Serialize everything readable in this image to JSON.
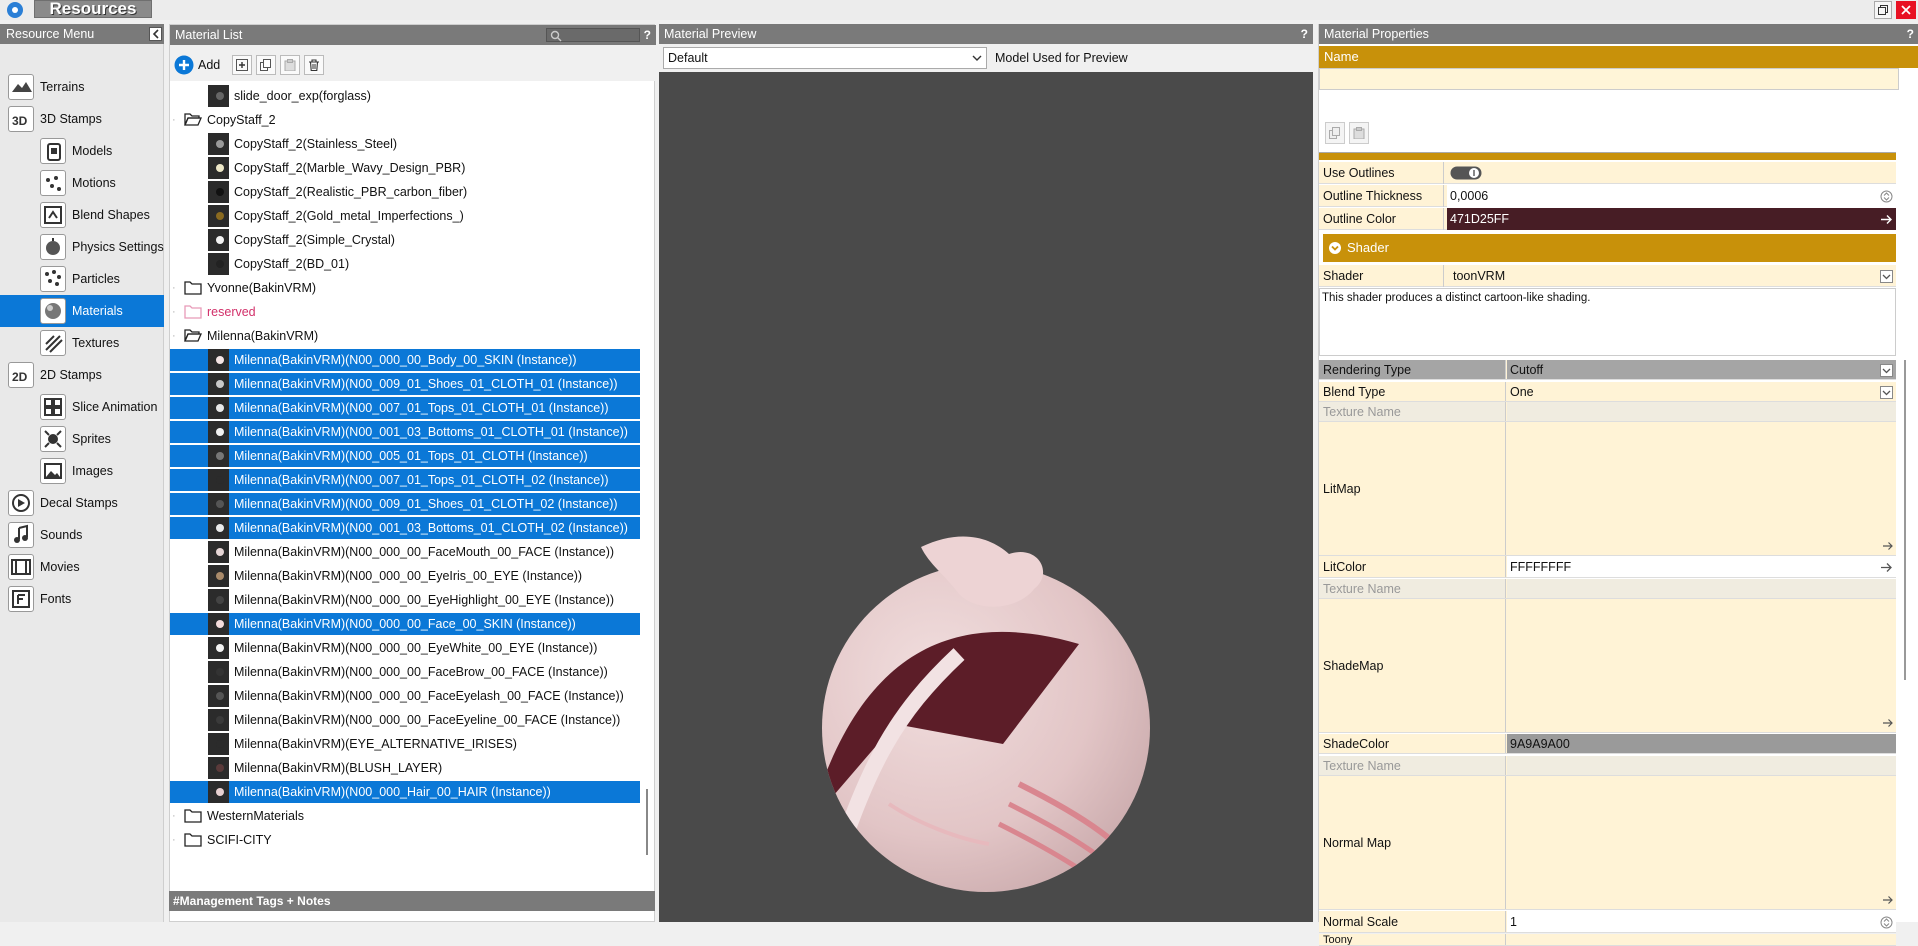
{
  "titlebar": {
    "title": "Resources"
  },
  "resource_menu": {
    "title": "Resource Menu",
    "items": [
      {
        "label": "Terrains",
        "icon": "terrain-icon",
        "selected": false,
        "sub": false
      },
      {
        "label": "3D Stamps",
        "icon": "3d-stamps-icon",
        "selected": false,
        "sub": false
      },
      {
        "label": "Models",
        "icon": "model-icon",
        "selected": false,
        "sub": true
      },
      {
        "label": "Motions",
        "icon": "motion-icon",
        "selected": false,
        "sub": true
      },
      {
        "label": "Blend Shapes",
        "icon": "blend-shapes-icon",
        "selected": false,
        "sub": true
      },
      {
        "label": "Physics Settings",
        "icon": "physics-icon",
        "selected": false,
        "sub": true
      },
      {
        "label": "Particles",
        "icon": "particles-icon",
        "selected": false,
        "sub": true
      },
      {
        "label": "Materials",
        "icon": "materials-icon",
        "selected": true,
        "sub": true
      },
      {
        "label": "Textures",
        "icon": "textures-icon",
        "selected": false,
        "sub": true
      },
      {
        "label": "2D Stamps",
        "icon": "2d-stamps-icon",
        "selected": false,
        "sub": false
      },
      {
        "label": "Slice Animation",
        "icon": "slice-animation-icon",
        "selected": false,
        "sub": true
      },
      {
        "label": "Sprites",
        "icon": "sprites-icon",
        "selected": false,
        "sub": true
      },
      {
        "label": "Images",
        "icon": "images-icon",
        "selected": false,
        "sub": true
      },
      {
        "label": "Decal Stamps",
        "icon": "decal-icon",
        "selected": false,
        "sub": false
      },
      {
        "label": "Sounds",
        "icon": "sound-icon",
        "selected": false,
        "sub": false
      },
      {
        "label": "Movies",
        "icon": "movie-icon",
        "selected": false,
        "sub": false
      },
      {
        "label": "Fonts",
        "icon": "font-icon",
        "selected": false,
        "sub": false
      }
    ]
  },
  "material_list": {
    "title": "Material List",
    "help": "?",
    "add_label": "Add",
    "rows": [
      {
        "kind": "material",
        "text": "slide_door_exp(forglass)",
        "selected": false,
        "dot": "#666"
      },
      {
        "kind": "folder-open",
        "text": "CopyStaff_2",
        "selected": false
      },
      {
        "kind": "material",
        "text": "CopyStaff_2(Stainless_Steel)",
        "selected": false,
        "dot": "#999"
      },
      {
        "kind": "material",
        "text": "CopyStaff_2(Marble_Wavy_Design_PBR)",
        "selected": false,
        "dot": "#eee8c8"
      },
      {
        "kind": "material",
        "text": "CopyStaff_2(Realistic_PBR_carbon_fiber)",
        "selected": false,
        "dot": "#111"
      },
      {
        "kind": "material",
        "text": "CopyStaff_2(Gold_metal_Imperfections_)",
        "selected": false,
        "dot": "#8a6a20"
      },
      {
        "kind": "material",
        "text": "CopyStaff_2(Simple_Crystal)",
        "selected": false,
        "dot": "#f2f2f2"
      },
      {
        "kind": "material",
        "text": "CopyStaff_2(BD_01)",
        "selected": false,
        "dot": "#222"
      },
      {
        "kind": "folder",
        "text": "Yvonne(BakinVRM)",
        "selected": false
      },
      {
        "kind": "folder-pink",
        "text": "reserved",
        "selected": false
      },
      {
        "kind": "folder-open",
        "text": "Milenna(BakinVRM)",
        "selected": false
      },
      {
        "kind": "material",
        "text": "Milenna(BakinVRM)(N00_000_00_Body_00_SKIN (Instance))",
        "selected": true,
        "dot": "#f4e4e4"
      },
      {
        "kind": "material",
        "text": "Milenna(BakinVRM)(N00_009_01_Shoes_01_CLOTH_01 (Instance))",
        "selected": true,
        "dot": "#c8c8c8"
      },
      {
        "kind": "material",
        "text": "Milenna(BakinVRM)(N00_007_01_Tops_01_CLOTH_01 (Instance))",
        "selected": true,
        "dot": "#e8e8e8"
      },
      {
        "kind": "material",
        "text": "Milenna(BakinVRM)(N00_001_03_Bottoms_01_CLOTH_01 (Instance))",
        "selected": true,
        "dot": "#f0f0f0"
      },
      {
        "kind": "material",
        "text": "Milenna(BakinVRM)(N00_005_01_Tops_01_CLOTH (Instance))",
        "selected": true,
        "dot": "#777"
      },
      {
        "kind": "material",
        "text": "Milenna(BakinVRM)(N00_007_01_Tops_01_CLOTH_02 (Instance))",
        "selected": true,
        "dot": "#2b2b2b"
      },
      {
        "kind": "material",
        "text": "Milenna(BakinVRM)(N00_009_01_Shoes_01_CLOTH_02 (Instance))",
        "selected": true,
        "dot": "#555"
      },
      {
        "kind": "material",
        "text": "Milenna(BakinVRM)(N00_001_03_Bottoms_01_CLOTH_02 (Instance))",
        "selected": true,
        "dot": "#eaeaea"
      },
      {
        "kind": "material",
        "text": "Milenna(BakinVRM)(N00_000_00_FaceMouth_00_FACE (Instance))",
        "selected": false,
        "dot": "#e6d6d6"
      },
      {
        "kind": "material",
        "text": "Milenna(BakinVRM)(N00_000_00_EyeIris_00_EYE (Instance))",
        "selected": false,
        "dot": "#a98a6a"
      },
      {
        "kind": "material",
        "text": "Milenna(BakinVRM)(N00_000_00_EyeHighlight_00_EYE (Instance))",
        "selected": false,
        "dot": "#444"
      },
      {
        "kind": "material",
        "text": "Milenna(BakinVRM)(N00_000_00_Face_00_SKIN (Instance))",
        "selected": true,
        "dot": "#f4dcdc"
      },
      {
        "kind": "material",
        "text": "Milenna(BakinVRM)(N00_000_00_EyeWhite_00_EYE (Instance))",
        "selected": false,
        "dot": "#f4f4f4"
      },
      {
        "kind": "material",
        "text": "Milenna(BakinVRM)(N00_000_00_FaceBrow_00_FACE (Instance))",
        "selected": false,
        "dot": "#333"
      },
      {
        "kind": "material",
        "text": "Milenna(BakinVRM)(N00_000_00_FaceEyelash_00_FACE (Instance))",
        "selected": false,
        "dot": "#555"
      },
      {
        "kind": "material",
        "text": "Milenna(BakinVRM)(N00_000_00_FaceEyeline_00_FACE (Instance))",
        "selected": false,
        "dot": "#3a3a3a"
      },
      {
        "kind": "material",
        "text": "Milenna(BakinVRM)(EYE_ALTERNATIVE_IRISES)",
        "selected": false,
        "dot": "#2b2b2b"
      },
      {
        "kind": "material",
        "text": "Milenna(BakinVRM)(BLUSH_LAYER)",
        "selected": false,
        "dot": "#5a3a3a"
      },
      {
        "kind": "material",
        "text": "Milenna(BakinVRM)(N00_000_Hair_00_HAIR (Instance))",
        "selected": true,
        "dot": "#e8d0d0"
      },
      {
        "kind": "folder",
        "text": "WesternMaterials",
        "selected": false
      },
      {
        "kind": "folder",
        "text": "SCIFI-CITY",
        "selected": false
      }
    ],
    "notes_title": "#Management Tags + Notes"
  },
  "material_preview": {
    "title": "Material Preview",
    "help": "?",
    "model_select": "Default",
    "model_label": "Model Used for Preview"
  },
  "material_properties": {
    "title": "Material Properties",
    "help": "?",
    "name_label": "Name",
    "name_value": "",
    "use_outlines": {
      "label": "Use Outlines",
      "on": true
    },
    "outline_thickness": {
      "label": "Outline Thickness",
      "value": "0,0006"
    },
    "outline_color": {
      "label": "Outline Color",
      "value": "471D25FF",
      "color": "#471D25"
    },
    "shader_section": "Shader",
    "shader": {
      "label": "Shader",
      "value": "toonVRM"
    },
    "shader_desc": "This shader produces a distinct cartoon-like shading.",
    "rendering_type": {
      "label": "Rendering Type",
      "value": "Cutoff"
    },
    "blend_type": {
      "label": "Blend Type",
      "value": "One"
    },
    "texture_name_label": "Texture Name",
    "litmap": {
      "label": "LitMap"
    },
    "litcolor": {
      "label": "LitColor",
      "value": "FFFFFFFF"
    },
    "shademap": {
      "label": "ShadeMap"
    },
    "shadecolor": {
      "label": "ShadeColor",
      "value": "9A9A9A00"
    },
    "normal_map": {
      "label": "Normal Map"
    },
    "normal_scale": {
      "label": "Normal Scale",
      "value": "1"
    },
    "toony": {
      "label": "Toony"
    }
  },
  "colors": {
    "accent": "#0b78d7",
    "gold": "#c8910a",
    "maroon": "#471d25"
  }
}
